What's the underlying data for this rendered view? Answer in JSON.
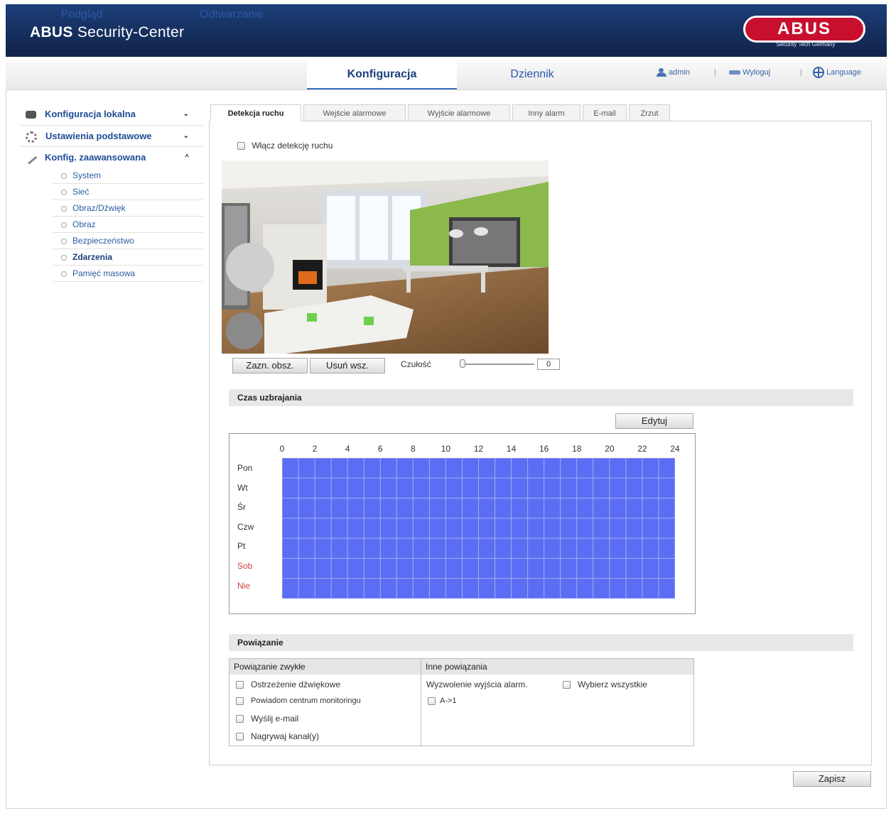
{
  "header": {
    "title_bold": "ABUS",
    "title_rest": "Security-Center",
    "logo_text": "ABUS",
    "logo_sub": "Security Tech Germany"
  },
  "nav": {
    "items": [
      {
        "label": "Podgląd"
      },
      {
        "label": "Odtwarzanie"
      },
      {
        "label": "Konfiguracja"
      },
      {
        "label": "Dziennik"
      }
    ],
    "user": "admin",
    "logout": "Wyloguj",
    "language": "Language",
    "separator": "|"
  },
  "sidebar": {
    "groups": [
      {
        "label": "Konfiguracja lokalna",
        "chevron": "⌄"
      },
      {
        "label": "Ustawienia podstawowe",
        "chevron": "⌄"
      },
      {
        "label": "Konfig. zaawansowana",
        "chevron": "^"
      }
    ],
    "items": [
      {
        "label": "System"
      },
      {
        "label": "Sieć"
      },
      {
        "label": "Obraz/Dźwięk"
      },
      {
        "label": "Obraz"
      },
      {
        "label": "Bezpieczeństwo"
      },
      {
        "label": "Zdarzenia"
      },
      {
        "label": "Pamięć masowa"
      }
    ]
  },
  "tabs": [
    {
      "label": "Detekcja ruchu"
    },
    {
      "label": "Wejście alarmowe"
    },
    {
      "label": "Wyjście alarmowe"
    },
    {
      "label": "Inny alarm"
    },
    {
      "label": "E-mail"
    },
    {
      "label": "Zrzut"
    }
  ],
  "motion": {
    "enable_label": "Włącz detekcję ruchu",
    "draw_area": "Zazn. obsz.",
    "clear_all": "Usuń wsz.",
    "sensitivity_label": "Czułość",
    "sensitivity_value": "0"
  },
  "schedule": {
    "section_title": "Czas uzbrajania",
    "edit_button": "Edytuj",
    "hours": [
      "0",
      "2",
      "4",
      "6",
      "8",
      "10",
      "12",
      "14",
      "16",
      "18",
      "20",
      "22",
      "24"
    ],
    "days": [
      "Pon",
      "Wt",
      "Śr",
      "Czw",
      "Pt",
      "Sob",
      "Nie"
    ],
    "fill_color": "#5b6df2"
  },
  "linkage": {
    "section_title": "Powiązanie",
    "normal_header": "Powiązanie zwykłe",
    "other_header": "Inne powiązania",
    "normal_items": [
      {
        "label": "Ostrzeżenie dźwiękowe"
      },
      {
        "label": "Powiadom centrum monitoringu"
      },
      {
        "label": "Wyślij e-mail"
      },
      {
        "label": "Nagrywaj kanał(y)"
      }
    ],
    "trigger_label": "Wyzwolenie wyjścia alarm.",
    "select_all": "Wybierz wszystkie",
    "output_item": "A->1"
  },
  "save_button": "Zapisz"
}
